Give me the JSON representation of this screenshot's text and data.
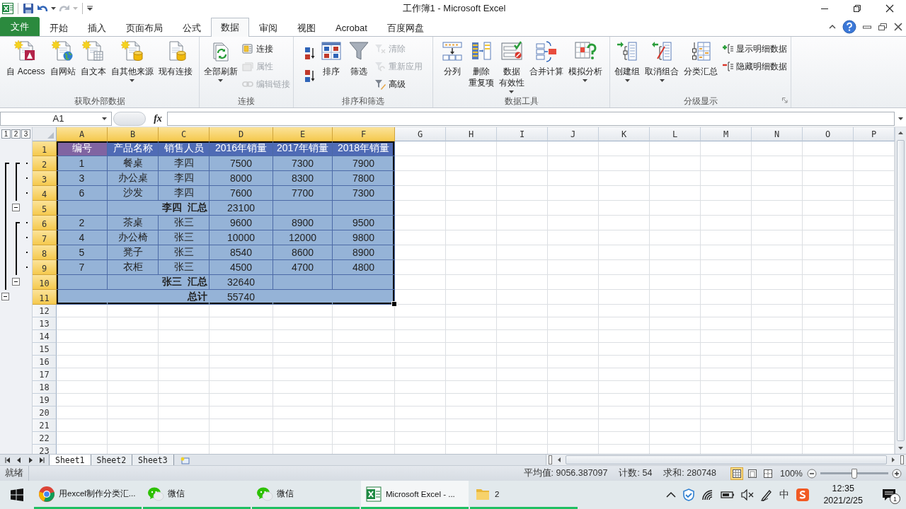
{
  "window": {
    "title": "工作簿1 - Microsoft Excel"
  },
  "ribbon_tabs": [
    {
      "label": "文件",
      "kind": "file",
      "selected": false
    },
    {
      "label": "开始",
      "kind": "tab",
      "selected": false
    },
    {
      "label": "插入",
      "kind": "tab",
      "selected": false
    },
    {
      "label": "页面布局",
      "kind": "tab",
      "selected": false
    },
    {
      "label": "公式",
      "kind": "tab",
      "selected": false
    },
    {
      "label": "数据",
      "kind": "tab",
      "selected": true
    },
    {
      "label": "审阅",
      "kind": "tab",
      "selected": false
    },
    {
      "label": "视图",
      "kind": "tab",
      "selected": false
    },
    {
      "label": "Acrobat",
      "kind": "tab",
      "selected": false
    },
    {
      "label": "百度网盘",
      "kind": "tab",
      "selected": false
    }
  ],
  "ribbon_groups": [
    {
      "label": "获取外部数据",
      "launcher": false,
      "items": [
        {
          "kind": "large",
          "lines": [
            "自 Access"
          ],
          "dropdown": false,
          "disabled": false
        },
        {
          "kind": "large",
          "lines": [
            "自网站"
          ],
          "dropdown": false,
          "disabled": false
        },
        {
          "kind": "large",
          "lines": [
            "自文本"
          ],
          "dropdown": false,
          "disabled": false
        },
        {
          "kind": "large",
          "lines": [
            "自其他来源"
          ],
          "dropdown": true,
          "disabled": false
        },
        {
          "kind": "large",
          "lines": [
            "现有连接"
          ],
          "dropdown": false,
          "disabled": false
        }
      ]
    },
    {
      "label": "连接",
      "launcher": false,
      "items": [
        {
          "kind": "large",
          "lines": [
            "全部刷新"
          ],
          "dropdown": true,
          "disabled": false
        },
        {
          "kind": "small",
          "label": "连接",
          "disabled": false
        },
        {
          "kind": "small",
          "label": "属性",
          "disabled": true
        },
        {
          "kind": "small",
          "label": "编辑链接",
          "disabled": true
        }
      ]
    },
    {
      "label": "排序和筛选",
      "launcher": false,
      "items": [
        {
          "kind": "icon",
          "disabled": false
        },
        {
          "kind": "icon",
          "disabled": false
        },
        {
          "kind": "large",
          "lines": [
            "排序"
          ],
          "dropdown": false,
          "disabled": false
        },
        {
          "kind": "large",
          "lines": [
            "筛选"
          ],
          "dropdown": false,
          "disabled": false
        },
        {
          "kind": "small",
          "label": "清除",
          "disabled": true
        },
        {
          "kind": "small",
          "label": "重新应用",
          "disabled": true
        },
        {
          "kind": "small",
          "label": "高级",
          "disabled": false
        }
      ]
    },
    {
      "label": "数据工具",
      "launcher": false,
      "items": [
        {
          "kind": "large",
          "lines": [
            "分列"
          ],
          "dropdown": false,
          "disabled": false
        },
        {
          "kind": "large",
          "lines": [
            "删除",
            "重复项"
          ],
          "dropdown": false,
          "disabled": false
        },
        {
          "kind": "large",
          "lines": [
            "数据",
            "有效性"
          ],
          "dropdown": true,
          "disabled": false
        },
        {
          "kind": "large",
          "lines": [
            "合并计算"
          ],
          "dropdown": false,
          "disabled": false
        },
        {
          "kind": "large",
          "lines": [
            "模拟分析"
          ],
          "dropdown": true,
          "disabled": false
        }
      ]
    },
    {
      "label": "分级显示",
      "launcher": true,
      "items": [
        {
          "kind": "large",
          "lines": [
            "创建组"
          ],
          "dropdown": true,
          "disabled": false
        },
        {
          "kind": "large",
          "lines": [
            "取消组合"
          ],
          "dropdown": true,
          "disabled": false
        },
        {
          "kind": "large",
          "lines": [
            "分类汇总"
          ],
          "dropdown": false,
          "disabled": false
        },
        {
          "kind": "small",
          "label": "显示明细数据",
          "disabled": false
        },
        {
          "kind": "small",
          "label": "隐藏明细数据",
          "disabled": false
        }
      ]
    }
  ],
  "formula_bar": {
    "name_box": "A1",
    "function_label": "fx"
  },
  "sheet": {
    "outline_levels": [
      "1",
      "2",
      "3"
    ],
    "columns": [
      {
        "letter": "A",
        "selected": true
      },
      {
        "letter": "B",
        "selected": true
      },
      {
        "letter": "C",
        "selected": true
      },
      {
        "letter": "D",
        "selected": true
      },
      {
        "letter": "E",
        "selected": true
      },
      {
        "letter": "F",
        "selected": true
      },
      {
        "letter": "G",
        "selected": false
      },
      {
        "letter": "H",
        "selected": false
      },
      {
        "letter": "I",
        "selected": false
      },
      {
        "letter": "J",
        "selected": false
      },
      {
        "letter": "K",
        "selected": false
      },
      {
        "letter": "L",
        "selected": false
      },
      {
        "letter": "M",
        "selected": false
      },
      {
        "letter": "N",
        "selected": false
      },
      {
        "letter": "O",
        "selected": false
      },
      {
        "letter": "P",
        "selected": false
      }
    ],
    "rows": [
      {
        "number": "1",
        "selected": true,
        "kind": "header",
        "cells": [
          {
            "text": "编号",
            "color": "#8064a2"
          },
          {
            "text": "产品名称",
            "color": "#4f6bb5"
          },
          {
            "text": "销售人员",
            "color": "#4f6bb5"
          },
          {
            "text": "2016年销量",
            "color": "#4f6bb5"
          },
          {
            "text": "2017年销量",
            "color": "#4f6bb5"
          },
          {
            "text": "2018年销量",
            "color": "#4f6bb5"
          }
        ]
      },
      {
        "number": "2",
        "selected": true,
        "kind": "detail",
        "cells": [
          "1",
          "餐桌",
          "李四",
          "7500",
          "7300",
          "7900"
        ]
      },
      {
        "number": "3",
        "selected": true,
        "kind": "detail",
        "cells": [
          "3",
          "办公桌",
          "李四",
          "8000",
          "8300",
          "7800"
        ]
      },
      {
        "number": "4",
        "selected": true,
        "kind": "detail",
        "cells": [
          "6",
          "沙发",
          "李四",
          "7600",
          "7700",
          "7300"
        ]
      },
      {
        "number": "5",
        "selected": true,
        "kind": "subtotal",
        "expanded": true,
        "label": "李四  汇总",
        "value": "23100"
      },
      {
        "number": "6",
        "selected": true,
        "kind": "detail",
        "cells": [
          "2",
          "茶桌",
          "张三",
          "9600",
          "8900",
          "9500"
        ]
      },
      {
        "number": "7",
        "selected": true,
        "kind": "detail",
        "cells": [
          "4",
          "办公椅",
          "张三",
          "10000",
          "12000",
          "9800"
        ]
      },
      {
        "number": "8",
        "selected": true,
        "kind": "detail",
        "cells": [
          "5",
          "凳子",
          "张三",
          "8540",
          "8600",
          "8900"
        ]
      },
      {
        "number": "9",
        "selected": true,
        "kind": "detail",
        "cells": [
          "7",
          "衣柜",
          "张三",
          "4500",
          "4700",
          "4800"
        ]
      },
      {
        "number": "10",
        "selected": true,
        "kind": "subtotal",
        "expanded": true,
        "label": "张三  汇总",
        "value": "32640"
      },
      {
        "number": "11",
        "selected": true,
        "kind": "total",
        "expanded": true,
        "label": "总计",
        "value": "55740"
      },
      {
        "number": "12",
        "selected": false,
        "kind": "empty"
      },
      {
        "number": "13",
        "selected": false,
        "kind": "empty"
      },
      {
        "number": "14",
        "selected": false,
        "kind": "empty"
      },
      {
        "number": "15",
        "selected": false,
        "kind": "empty"
      },
      {
        "number": "16",
        "selected": false,
        "kind": "empty"
      },
      {
        "number": "17",
        "selected": false,
        "kind": "empty"
      },
      {
        "number": "18",
        "selected": false,
        "kind": "empty"
      },
      {
        "number": "19",
        "selected": false,
        "kind": "empty"
      },
      {
        "number": "20",
        "selected": false,
        "kind": "empty"
      },
      {
        "number": "21",
        "selected": false,
        "kind": "empty"
      },
      {
        "number": "22",
        "selected": false,
        "kind": "empty"
      },
      {
        "number": "23",
        "selected": false,
        "kind": "empty"
      }
    ]
  },
  "sheet_tabs": [
    {
      "label": "Sheet1",
      "selected": true
    },
    {
      "label": "Sheet2",
      "selected": false
    },
    {
      "label": "Sheet3",
      "selected": false
    }
  ],
  "status_bar": {
    "mode": "就绪",
    "average": "平均值: 9056.387097",
    "count": "计数: 54",
    "sum": "求和: 280748",
    "views": [
      {
        "selected": true
      },
      {
        "selected": false
      },
      {
        "selected": false
      }
    ],
    "zoom": "100%",
    "zoom_slider": {
      "level": 0.5
    }
  },
  "taskbar": {
    "items": [
      {
        "kind": "browser",
        "label": "用excel制作分类汇...",
        "active": false
      },
      {
        "kind": "chat",
        "label": "微信",
        "active": false
      },
      {
        "kind": "chat",
        "label": "微信",
        "active": false
      },
      {
        "kind": "spreadsheet",
        "label": "Microsoft Excel - ...",
        "active": true
      },
      {
        "kind": "folder",
        "label": "2",
        "active": false
      }
    ],
    "tray": {
      "ime": "中",
      "time": "12:35",
      "date": "2021/2/25",
      "notifications": "1"
    }
  }
}
